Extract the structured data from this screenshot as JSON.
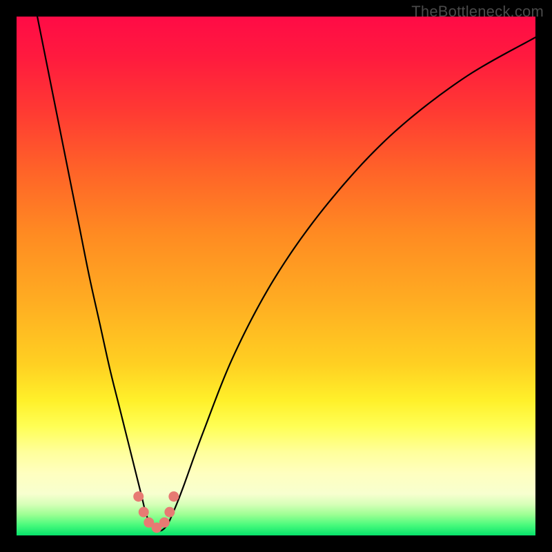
{
  "watermark": "TheBottleneck.com",
  "chart_data": {
    "type": "line",
    "title": "",
    "xlabel": "",
    "ylabel": "",
    "xlim": [
      0,
      100
    ],
    "ylim": [
      0,
      100
    ],
    "series": [
      {
        "name": "bottleneck-curve",
        "x": [
          4,
          6,
          8,
          10,
          12,
          14,
          16,
          18,
          20,
          22,
          24,
          25,
          26,
          27,
          28,
          29,
          30,
          32,
          36,
          42,
          50,
          60,
          72,
          86,
          100
        ],
        "values": [
          100,
          90,
          80,
          70,
          60,
          50,
          41,
          32,
          24,
          16,
          8,
          4,
          2,
          1,
          1,
          2,
          4,
          9,
          20,
          35,
          50,
          64,
          77,
          88,
          96
        ]
      }
    ],
    "markers": {
      "name": "bottleneck-markers",
      "x": [
        23.5,
        24.5,
        25.5,
        27.0,
        28.5,
        29.5,
        30.3
      ],
      "values": [
        7.5,
        4.5,
        2.5,
        1.5,
        2.5,
        4.5,
        7.5
      ]
    },
    "colors": {
      "curve": "#000000",
      "marker": "#e77a73",
      "gradient_top": "#ff0b46",
      "gradient_bottom": "#07e36b"
    }
  }
}
